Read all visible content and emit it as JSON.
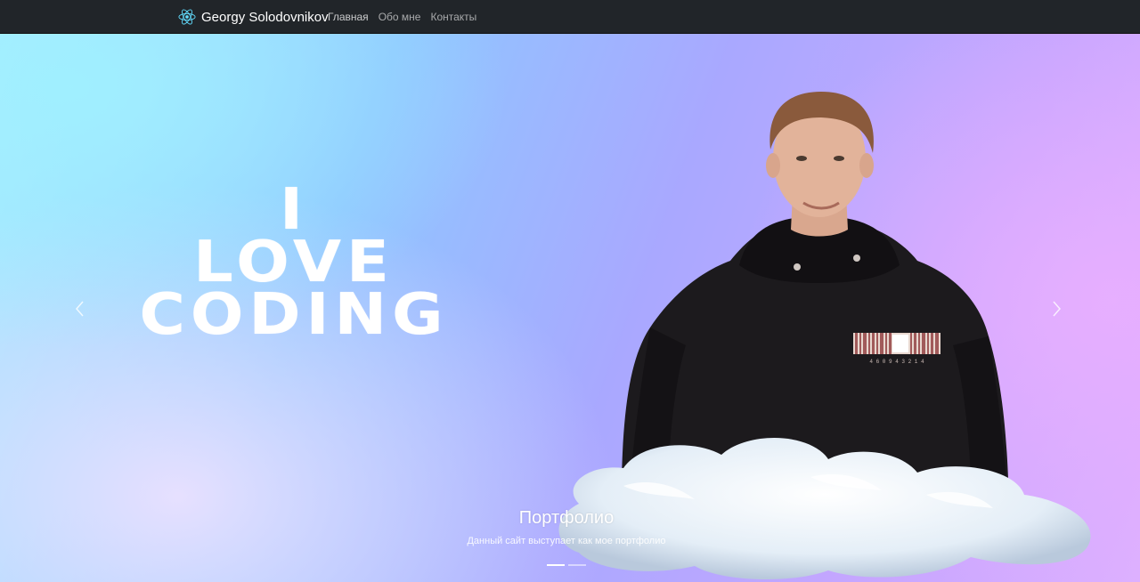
{
  "navbar": {
    "brand_label": "Georgy Solodovnikov",
    "brand_icon": "react-atom-icon",
    "links": [
      {
        "label": "Главная"
      },
      {
        "label": "Обо мне"
      },
      {
        "label": "Контакты"
      }
    ]
  },
  "hero": {
    "lines": [
      "I",
      "LOVE",
      "CODING"
    ]
  },
  "carousel": {
    "caption_title": "Портфолио",
    "caption_text": "Данный сайт выступает как мое портфолио",
    "prev_icon": "chevron-left-icon",
    "next_icon": "chevron-right-icon",
    "indicator_count": 2,
    "active_indicator": 0,
    "barcode_digits": "4 6 0 9 4 3 2 1 4"
  },
  "colors": {
    "navbar_bg": "#212529",
    "accent_react": "#61dafb",
    "hoodie": "#1c1a1d"
  }
}
